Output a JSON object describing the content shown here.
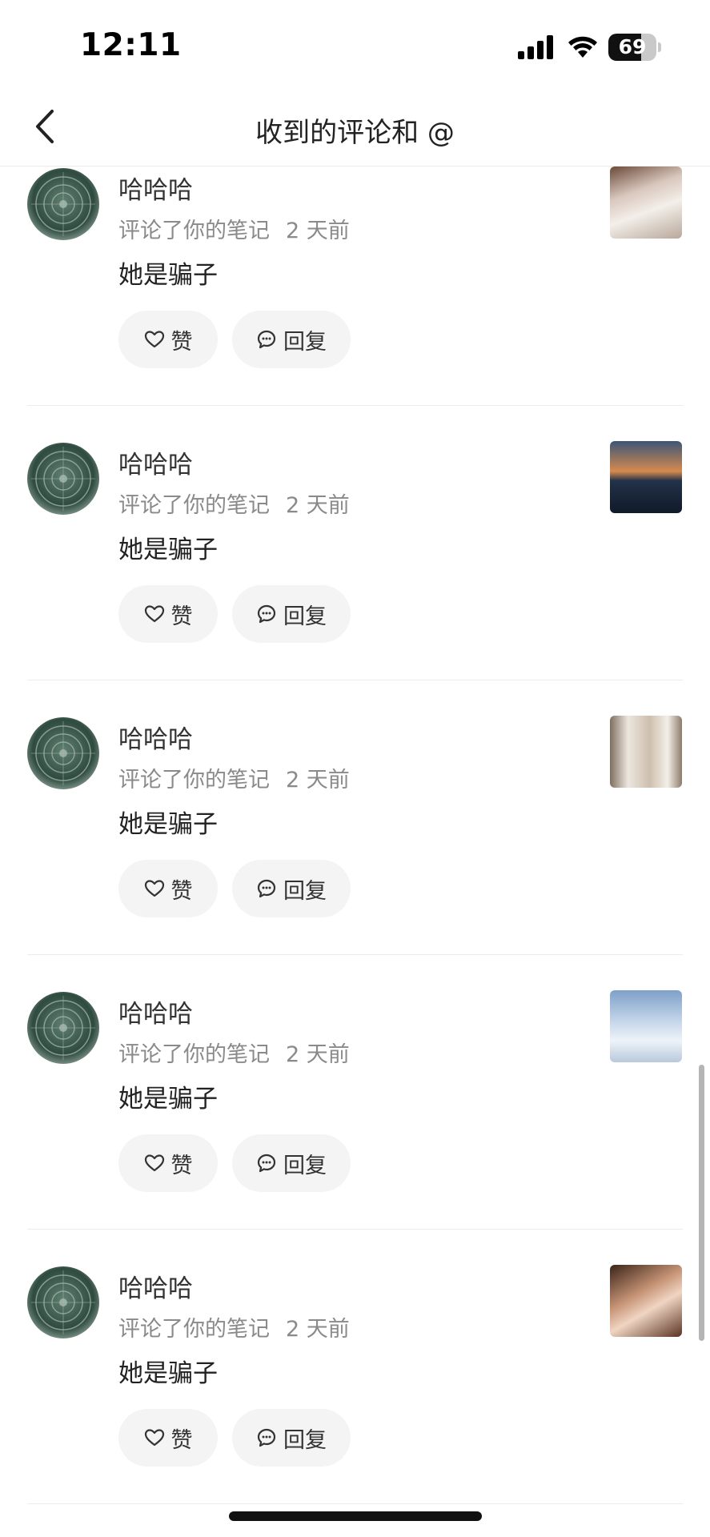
{
  "status_bar": {
    "time": "12:11",
    "battery": "69",
    "battery_level": 0.69
  },
  "nav": {
    "title": "收到的评论和 @",
    "back_icon": "chevron-left-icon"
  },
  "comments": [
    {
      "user": "哈哈哈",
      "action": "评论了你的笔记",
      "time": "2 天前",
      "text": "她是骗子",
      "like_label": "赞",
      "reply_label": "回复"
    },
    {
      "user": "哈哈哈",
      "action": "评论了你的笔记",
      "time": "2 天前",
      "text": "她是骗子",
      "like_label": "赞",
      "reply_label": "回复"
    },
    {
      "user": "哈哈哈",
      "action": "评论了你的笔记",
      "time": "2 天前",
      "text": "她是骗子",
      "like_label": "赞",
      "reply_label": "回复"
    },
    {
      "user": "哈哈哈",
      "action": "评论了你的笔记",
      "time": "2 天前",
      "text": "她是骗子",
      "like_label": "赞",
      "reply_label": "回复"
    },
    {
      "user": "哈哈哈",
      "action": "评论了你的笔记",
      "time": "2 天前",
      "text": "她是骗子",
      "like_label": "赞",
      "reply_label": "回复"
    }
  ],
  "colors": {
    "button_bg": "#f4f4f4",
    "meta_text": "#8a8a8a",
    "divider": "#ececec"
  }
}
